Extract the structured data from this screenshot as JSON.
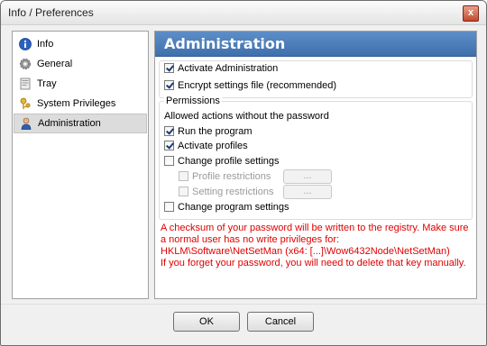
{
  "window": {
    "title": "Info / Preferences",
    "close_glyph": "x"
  },
  "sidebar": {
    "items": [
      {
        "label": "Info",
        "icon": "info-icon"
      },
      {
        "label": "General",
        "icon": "gear-icon"
      },
      {
        "label": "Tray",
        "icon": "tray-icon"
      },
      {
        "label": "System Privileges",
        "icon": "keys-icon"
      },
      {
        "label": "Administration",
        "icon": "admin-user-icon"
      }
    ],
    "selected_index": 4
  },
  "panel": {
    "header": "Administration",
    "activate_admin": {
      "label": "Activate Administration",
      "checked": true
    },
    "encrypt_settings": {
      "label": "Encrypt settings file (recommended)",
      "checked": true
    },
    "permissions": {
      "group_title": "Permissions",
      "subtitle": "Allowed actions without the password",
      "run_program": {
        "label": "Run the program",
        "checked": true
      },
      "activate_profiles": {
        "label": "Activate profiles",
        "checked": true
      },
      "change_profile_settings": {
        "label": "Change profile settings",
        "checked": false
      },
      "profile_restrictions": {
        "label": "Profile restrictions",
        "checked": false,
        "button": "..."
      },
      "setting_restrictions": {
        "label": "Setting restrictions",
        "checked": false,
        "button": "..."
      },
      "change_program_settings": {
        "label": "Change program settings",
        "checked": false
      }
    },
    "warning_lines": [
      "A checksum of your password will be written to the registry. Make sure",
      "a normal user has no write privileges for:",
      "HKLM\\Software\\NetSetMan (x64: [...]\\Wow6432Node\\NetSetMan)",
      "If you forget your password, you will need to delete that key manually."
    ]
  },
  "buttons": {
    "ok": "OK",
    "cancel": "Cancel"
  },
  "colors": {
    "header_blue": "#4a7dbb",
    "warning_red": "#e00000"
  }
}
